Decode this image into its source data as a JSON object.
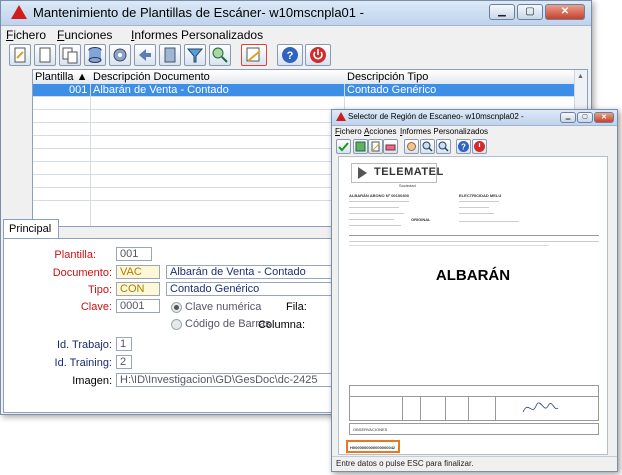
{
  "main_window": {
    "title": "Mantenimiento de Plantillas de Escáner- w10mscnpla01 -",
    "menu": [
      "Fichero",
      "Funciones",
      "Informes Personalizados"
    ],
    "toolbar_icons": [
      "new-doc-icon",
      "blank-doc-icon",
      "copy-doc-icon",
      "database-icon",
      "gear-icon",
      "back-arrow-icon",
      "save-doc-icon",
      "filter-icon",
      "search-icon",
      "edit-scan-icon",
      "help-icon",
      "power-icon"
    ],
    "grid": {
      "columns": [
        "Plantilla",
        "Descripción Documento",
        "Descripción Tipo"
      ],
      "sort_indicator": "▲",
      "rows": [
        {
          "plantilla": "001",
          "documento": "Albarán de Venta - Contado",
          "tipo": "Contado Genérico",
          "selected": true
        }
      ]
    },
    "tab_label": "Principal",
    "form": {
      "plantilla_label": "Plantilla:",
      "plantilla_value": "001",
      "documento_label": "Documento:",
      "documento_code": "VAC",
      "documento_desc": "Albarán de Venta - Contado",
      "tipo_label": "Tipo:",
      "tipo_code": "CON",
      "tipo_desc": "Contado Genérico",
      "clave_label": "Clave:",
      "clave_value": "0001",
      "clave_numerica": "Clave numérica",
      "codigo_barras": "Código de Barras",
      "fila_label": "Fila:",
      "columna_label": "Columna:",
      "id_trabajo_label": "Id. Trabajo:",
      "id_trabajo_value": "1",
      "id_training_label": "Id. Training:",
      "id_training_value": "2",
      "imagen_label": "Imagen:",
      "imagen_value": "H:\\ID\\Investigacion\\GD\\GesDoc\\dc-2425"
    }
  },
  "second_window": {
    "title": "Selector de Región de Escaneo- w10mscnpla02 -",
    "menu": [
      "Fichero",
      "Acciones",
      "Informes Personalizados"
    ],
    "toolbar_icons": [
      "check-icon",
      "save-icon",
      "edit-icon",
      "eraser-icon",
      "hand-icon",
      "zoom-in-icon",
      "zoom-out-icon",
      "help-icon",
      "power-icon"
    ],
    "document": {
      "company": "TELEMATEL",
      "company_sub": "Sociedad",
      "heading": "ALBARÁN ABONO Nº 00100400",
      "original_label": "ORIGINAL",
      "client": "ELECTRICIDAD MELU",
      "big_label": "ALBARÁN",
      "footer_label": "OBSERVACIONES",
      "barcode_text": "H0000000000000000042"
    },
    "status_text": "Entre datos o pulse ESC para finalizar."
  },
  "colors": {
    "selection": "#3d8ee6",
    "required_label": "#cc1111",
    "optional_label": "#1c2a6e",
    "highlight_box": "#e87722"
  }
}
